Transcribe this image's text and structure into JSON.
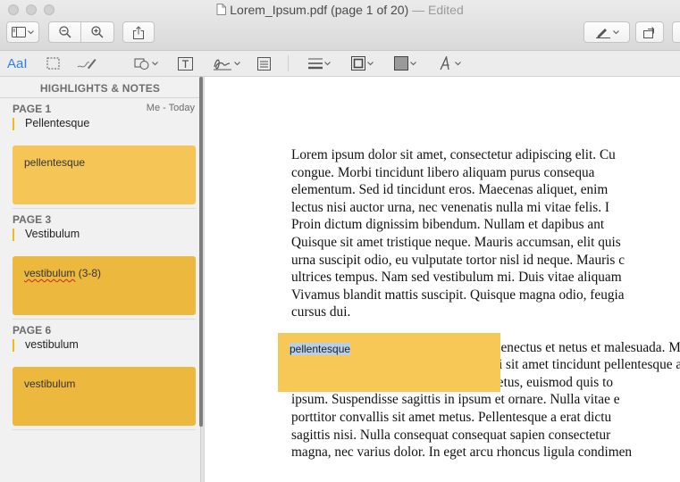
{
  "window": {
    "title": "Lorem_Ipsum.pdf (page 1 of 20)",
    "edited": "— Edited"
  },
  "toolbar": {
    "buttons": [
      "sidebar-toggle",
      "zoom-out",
      "zoom-in",
      "share",
      "markup-pen",
      "rotate"
    ]
  },
  "markup_toolbar": {
    "text_selection_label": "AaI"
  },
  "sidebar": {
    "header": "HIGHLIGHTS & NOTES",
    "groups": [
      {
        "page": "PAGE 1",
        "meta": "Me - Today",
        "highlight": "Pellentesque",
        "note": "pellentesque",
        "note_color": "#f5c655"
      },
      {
        "page": "PAGE 3",
        "highlight": "Vestibulum",
        "note_word": "vestibulum",
        "note_suffix": " (3-8)",
        "note_color": "#ecb83e"
      },
      {
        "page": "PAGE 6",
        "highlight": "vestibulum",
        "note": "vestibulum",
        "note_color": "#ecb83e"
      }
    ]
  },
  "document": {
    "lines": [
      "Lorem ipsum dolor sit amet, consectetur adipiscing elit. Cu",
      "congue. Morbi tincidunt libero aliquam purus consequa",
      "elementum. Sed id tincidunt eros. Maecenas aliquet, enim",
      "lectus nisi auctor urna, nec venenatis nulla mi vitae felis. I",
      "Proin dictum dignissim bibendum. Nullam et dapibus ant",
      "Quisque sit amet tristique neque. Mauris accumsan, elit quis",
      "urna suscipit odio, eu vulputate tortor nisl id neque. Mauris c",
      "ultrices tempus. Nam sed vestibulum mi. Duis vitae aliquam",
      "Vivamus blandit mattis suscipit. Quisque magna odio, feugia",
      "cursus dui."
    ],
    "lines2": [
      "Pellentesque habitant morbi tristique senectus et netus et malesuada. Mauris quis finibus et, sodales",
      "fames ac turpis egestas. Sed mattis, mi sit amet tincidunt pellentesque ac justo sed viv",
      "dui viverra efficitur. Quisque quam metus, euismod quis to",
      "ipsum. Suspendisse sagittis in ipsum et ornare. Nulla vitae e",
      "porttitor convallis sit amet metus. Pellentesque a erat dictu",
      "sagittis nisi. Nulla consequat consequat sapien consectetur",
      "magna, nec varius dolor. In eget arcu rhoncus ligula condimen"
    ],
    "note_popup": "pellentesque"
  }
}
